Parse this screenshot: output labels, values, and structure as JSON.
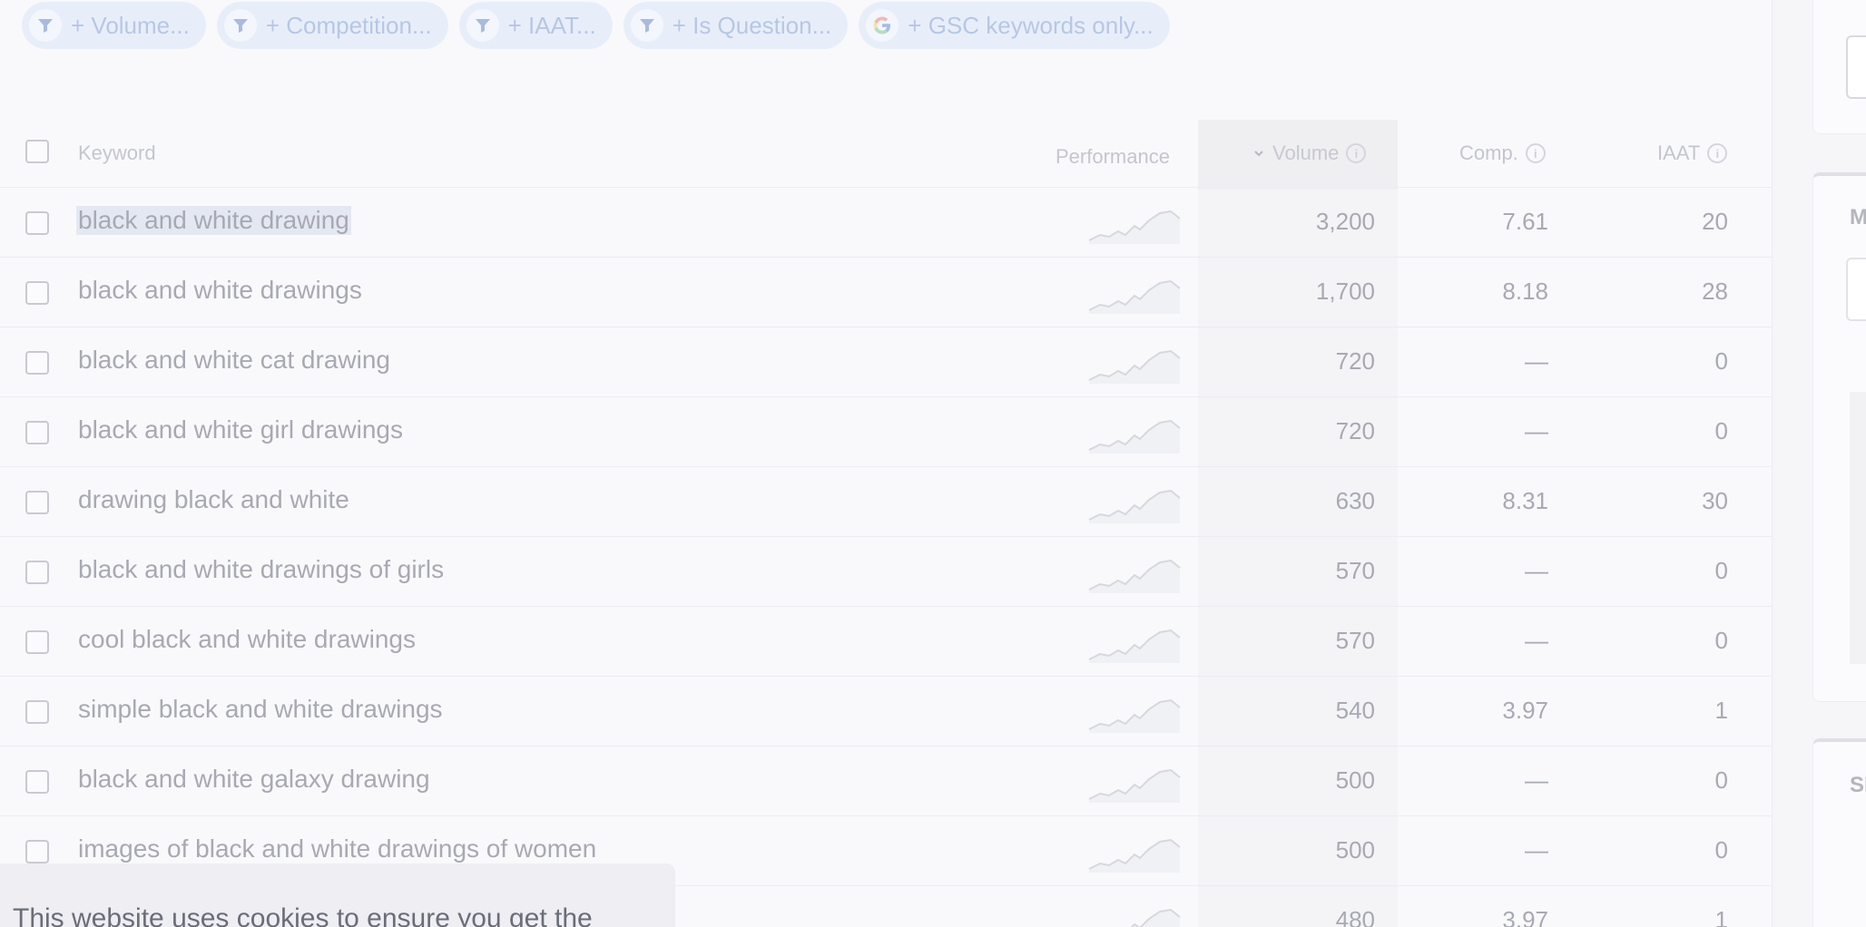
{
  "filters": [
    {
      "icon": "filter-icon",
      "label": "+ Volume..."
    },
    {
      "icon": "filter-icon",
      "label": "+ Competition..."
    },
    {
      "icon": "filter-icon",
      "label": "+ IAAT..."
    },
    {
      "icon": "filter-icon",
      "label": "+ Is Question..."
    },
    {
      "icon": "google-icon",
      "label": "+ GSC keywords only..."
    }
  ],
  "table": {
    "headers": {
      "keyword": "Keyword",
      "performance": "Performance",
      "volume": "Volume",
      "comp": "Comp.",
      "iaat": "IAAT"
    },
    "sort": {
      "column": "volume",
      "icon": "chevron-down-icon"
    },
    "rows": [
      {
        "keyword": "black and white drawing",
        "volume": "3,200",
        "comp": "7.61",
        "iaat": "20"
      },
      {
        "keyword": "black and white drawings",
        "volume": "1,700",
        "comp": "8.18",
        "iaat": "28"
      },
      {
        "keyword": "black and white cat drawing",
        "volume": "720",
        "comp": "—",
        "iaat": "0"
      },
      {
        "keyword": "black and white girl drawings",
        "volume": "720",
        "comp": "—",
        "iaat": "0"
      },
      {
        "keyword": "drawing black and white",
        "volume": "630",
        "comp": "8.31",
        "iaat": "30"
      },
      {
        "keyword": "black and white drawings of girls",
        "volume": "570",
        "comp": "—",
        "iaat": "0"
      },
      {
        "keyword": "cool black and white drawings",
        "volume": "570",
        "comp": "—",
        "iaat": "0"
      },
      {
        "keyword": "simple black and white drawings",
        "volume": "540",
        "comp": "3.97",
        "iaat": "1"
      },
      {
        "keyword": "black and white galaxy drawing",
        "volume": "500",
        "comp": "—",
        "iaat": "0"
      },
      {
        "keyword": "images of black and white drawings of women",
        "volume": "500",
        "comp": "—",
        "iaat": "0"
      },
      {
        "keyword": "",
        "volume": "480",
        "comp": "3.97",
        "iaat": "1"
      }
    ]
  },
  "right_panel": {
    "label_m": "M",
    "label_s": "SI"
  },
  "cookie_banner": {
    "text": "This website uses cookies to ensure you get the"
  },
  "colors": {
    "chip_bg": "#e8eef9",
    "chip_text": "#b6c7e6",
    "row_text": "#a8a9b2",
    "banner_bg": "#eeeef3"
  }
}
